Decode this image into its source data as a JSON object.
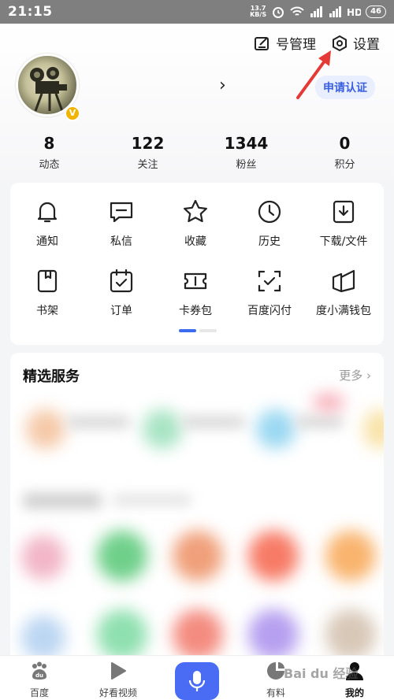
{
  "status_bar": {
    "time": "21:15",
    "net_speed_value": "13.7",
    "net_speed_unit": "KB/S",
    "battery": "46"
  },
  "top_actions": {
    "account_manage": "号管理",
    "settings": "设置"
  },
  "profile": {
    "certify_label": "申请认证",
    "badge": "V"
  },
  "stats": [
    {
      "value": "8",
      "label": "动态"
    },
    {
      "value": "122",
      "label": "关注"
    },
    {
      "value": "1344",
      "label": "粉丝"
    },
    {
      "value": "0",
      "label": "积分"
    }
  ],
  "grid_items": [
    {
      "label": "通知",
      "icon": "bell-icon"
    },
    {
      "label": "私信",
      "icon": "message-icon"
    },
    {
      "label": "收藏",
      "icon": "star-icon"
    },
    {
      "label": "历史",
      "icon": "clock-icon"
    },
    {
      "label": "下载/文件",
      "icon": "download-icon"
    },
    {
      "label": "书架",
      "icon": "bookmark-icon"
    },
    {
      "label": "订单",
      "icon": "calendar-check-icon"
    },
    {
      "label": "卡券包",
      "icon": "ticket-icon"
    },
    {
      "label": "百度闪付",
      "icon": "scan-check-icon"
    },
    {
      "label": "度小满钱包",
      "icon": "wallet-icon"
    }
  ],
  "services": {
    "title": "精选服务",
    "more": "更多 ›"
  },
  "tabbar": [
    {
      "label": "百度",
      "icon": "paw-icon"
    },
    {
      "label": "好看视频",
      "icon": "play-icon"
    },
    {
      "label": "",
      "icon": "mic-icon"
    },
    {
      "label": "有料",
      "icon": "leaf-icon"
    },
    {
      "label": "我的",
      "icon": "person-icon"
    }
  ],
  "watermark": "Bai du 经验",
  "colors": {
    "accent": "#3b6cf0",
    "mic": "#4a6cf5",
    "arrow": "#e53935",
    "badge": "#f2b400"
  }
}
